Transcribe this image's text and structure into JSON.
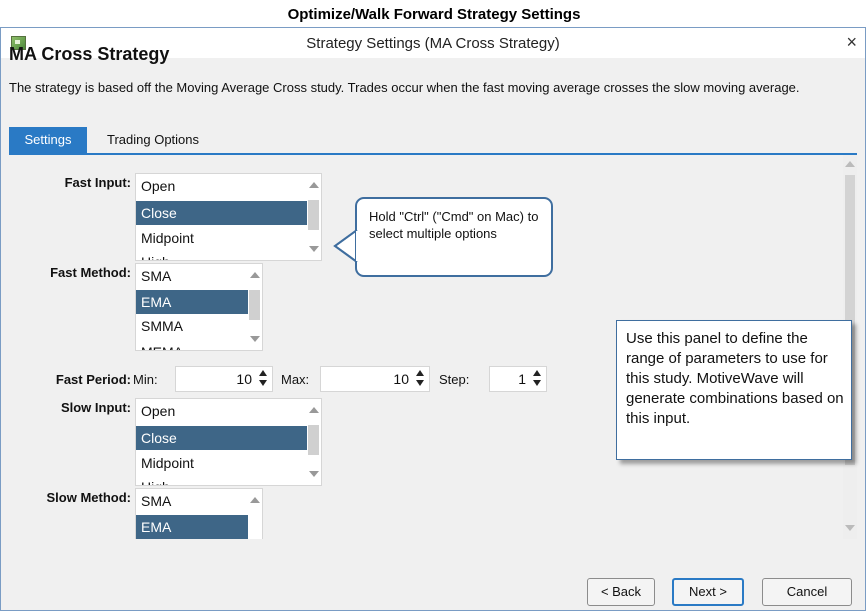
{
  "caption": "Optimize/Walk Forward Strategy Settings",
  "window": {
    "title": "Strategy Settings (MA Cross Strategy)",
    "close_glyph": "×",
    "icon": "app-icon"
  },
  "strategy": {
    "name": "MA Cross Strategy",
    "description": "The strategy is based off the Moving Average Cross study. Trades occur when the fast moving average crosses the slow moving average."
  },
  "tabs": [
    {
      "label": "Settings",
      "active": true
    },
    {
      "label": "Trading Options",
      "active": false
    }
  ],
  "settings": {
    "fast_input": {
      "label": "Fast Input:",
      "items": [
        "Open",
        "Close",
        "Midpoint",
        "High"
      ],
      "selected": "Close"
    },
    "fast_method": {
      "label": "Fast Method:",
      "items": [
        "SMA",
        "EMA",
        "SMMA",
        "MEMA"
      ],
      "selected": "EMA"
    },
    "fast_period": {
      "label": "Fast Period:",
      "min_label": "Min:",
      "min_value": "10",
      "max_label": "Max:",
      "max_value": "10",
      "step_label": "Step:",
      "step_value": "1"
    },
    "slow_input": {
      "label": "Slow Input:",
      "items": [
        "Open",
        "Close",
        "Midpoint",
        "High"
      ],
      "selected": "Close"
    },
    "slow_method": {
      "label": "Slow Method:",
      "items": [
        "SMA",
        "EMA"
      ],
      "selected": "EMA"
    }
  },
  "callout": {
    "text": "Hold \"Ctrl\" (\"Cmd\" on Mac) to select multiple options"
  },
  "note": {
    "text": "Use this panel to define the range of parameters to use for this study.  MotiveWave will generate combinations based on this input."
  },
  "buttons": {
    "back": "< Back",
    "next": "Next >",
    "cancel": "Cancel"
  },
  "colors": {
    "accent": "#2a7ac5",
    "selection": "#3e6687",
    "callout_border": "#3f6e9f"
  }
}
